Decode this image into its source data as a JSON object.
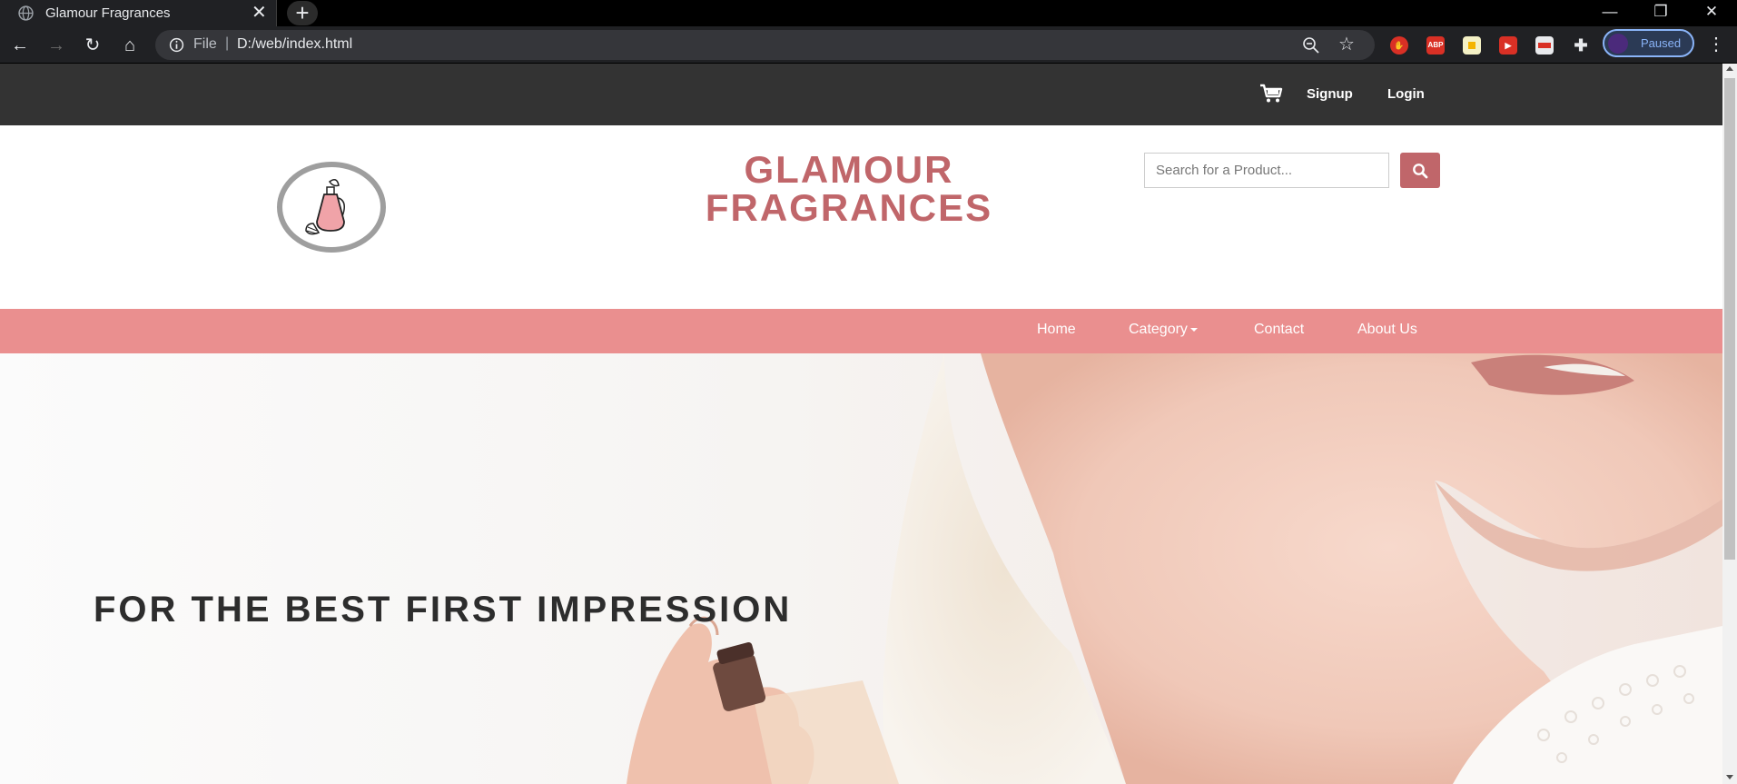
{
  "browser": {
    "tab_title": "Glamour Fragrances",
    "url_scheme": "File",
    "url_separator": "|",
    "url": "D:/web/index.html",
    "profile_status": "Paused",
    "extensions": [
      "adblock-stop-icon",
      "abp-icon",
      "extension-yellow-icon",
      "extension-video-icon",
      "extension-card-icon",
      "puzzle-icon"
    ]
  },
  "topbar": {
    "signup": "Signup",
    "login": "Login"
  },
  "header": {
    "brand_line1": "GLAMOUR",
    "brand_line2": "FRAGRANCES",
    "search_placeholder": "Search for a Product..."
  },
  "nav": {
    "items": [
      "Home",
      "Category",
      "Contact",
      "About Us"
    ]
  },
  "hero": {
    "headline": "FOR THE BEST FIRST IMPRESSION"
  },
  "colors": {
    "brand": "#c0666a",
    "navbar": "#ea8f8f",
    "topbar": "#333333"
  }
}
